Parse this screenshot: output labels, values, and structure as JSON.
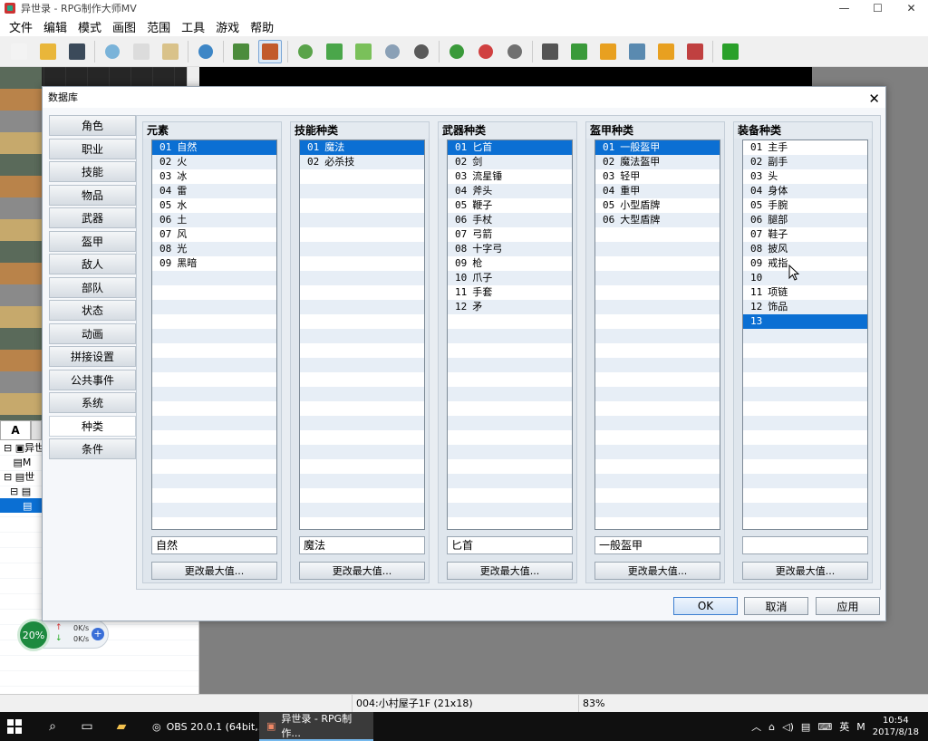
{
  "window": {
    "title": "异世录 - RPG制作大师MV",
    "minimize": "—",
    "maximize": "☐",
    "close": "✕"
  },
  "menu": [
    "文件",
    "编辑",
    "模式",
    "画图",
    "范围",
    "工具",
    "游戏",
    "帮助"
  ],
  "toolbar": {
    "icons": [
      "new-project-icon",
      "open-project-icon",
      "save-icon",
      "cut-icon",
      "copy-icon",
      "paste-icon",
      "undo-icon",
      "map-mode-icon",
      "event-mode-icon",
      "pencil-icon",
      "rectangle-icon",
      "ellipse-icon",
      "fill-icon",
      "shadow-pen-icon",
      "zoom-in-icon",
      "zoom-out-icon",
      "zoom-actual-icon",
      "database-icon",
      "plugin-icon",
      "sound-test-icon",
      "event-search-icon",
      "resource-manager-icon",
      "character-generator-icon",
      "playtest-icon"
    ],
    "colors": [
      "#f3f3f3",
      "#e9b63a",
      "#3b4a5a",
      "#7ab3d9",
      "#dcdcdc",
      "#d9c28a",
      "#3d86c6",
      "#4c8c3c",
      "#c25a2b",
      "#5aa34a",
      "#4aa64a",
      "#7ac05a",
      "#8aa0b6",
      "#5a5a5a",
      "#3a9a3a",
      "#d04040",
      "#707070",
      "#555555",
      "#3a9a3a",
      "#e8a020",
      "#5a8ab0",
      "#e8a020",
      "#c04040",
      "#2aa02a"
    ]
  },
  "left_panel": {
    "tab_a": "A",
    "tree": [
      "异世",
      "M",
      "世",
      "",
      ""
    ]
  },
  "network": {
    "percent": "20%",
    "up": "0K/s",
    "down": "0K/s",
    "up_arrow": "↑",
    "down_arrow": "↓",
    "plus": "+"
  },
  "status": {
    "map": "004:小村屋子1F (21x18)",
    "zoom": "83%"
  },
  "taskbar": {
    "apps": [
      {
        "label": "OBS 20.0.1 (64bit,..."
      },
      {
        "label": "异世录 - RPG制作..."
      }
    ],
    "tray_ime": "英",
    "tray_m": "M",
    "time": "10:54",
    "date": "2017/8/18"
  },
  "dialog": {
    "title": "数据库",
    "close": "✕",
    "nav": [
      "角色",
      "职业",
      "技能",
      "物品",
      "武器",
      "盔甲",
      "敌人",
      "部队",
      "状态",
      "动画",
      "拼接设置",
      "公共事件",
      "系统",
      "种类",
      "条件"
    ],
    "selected_nav": 13,
    "columns": [
      {
        "title": "元素",
        "items": [
          {
            "num": "01",
            "name": "自然"
          },
          {
            "num": "02",
            "name": "火"
          },
          {
            "num": "03",
            "name": "冰"
          },
          {
            "num": "04",
            "name": "雷"
          },
          {
            "num": "05",
            "name": "水"
          },
          {
            "num": "06",
            "name": "土"
          },
          {
            "num": "07",
            "name": "风"
          },
          {
            "num": "08",
            "name": "光"
          },
          {
            "num": "09",
            "name": "黑暗"
          }
        ],
        "selected": 0,
        "field": "自然",
        "button": "更改最大值..."
      },
      {
        "title": "技能种类",
        "items": [
          {
            "num": "01",
            "name": "魔法"
          },
          {
            "num": "02",
            "name": "必杀技"
          }
        ],
        "selected": 0,
        "field": "魔法",
        "button": "更改最大值..."
      },
      {
        "title": "武器种类",
        "items": [
          {
            "num": "01",
            "name": "匕首"
          },
          {
            "num": "02",
            "name": "剑"
          },
          {
            "num": "03",
            "name": "流星锤"
          },
          {
            "num": "04",
            "name": "斧头"
          },
          {
            "num": "05",
            "name": "鞭子"
          },
          {
            "num": "06",
            "name": "手杖"
          },
          {
            "num": "07",
            "name": "弓箭"
          },
          {
            "num": "08",
            "name": "十字弓"
          },
          {
            "num": "09",
            "name": "枪"
          },
          {
            "num": "10",
            "name": "爪子"
          },
          {
            "num": "11",
            "name": "手套"
          },
          {
            "num": "12",
            "name": "矛"
          }
        ],
        "selected": 0,
        "field": "匕首",
        "button": "更改最大值..."
      },
      {
        "title": "盔甲种类",
        "items": [
          {
            "num": "01",
            "name": "一般盔甲"
          },
          {
            "num": "02",
            "name": "魔法盔甲"
          },
          {
            "num": "03",
            "name": "轻甲"
          },
          {
            "num": "04",
            "name": "重甲"
          },
          {
            "num": "05",
            "name": "小型盾牌"
          },
          {
            "num": "06",
            "name": "大型盾牌"
          }
        ],
        "selected": 0,
        "field": "一般盔甲",
        "button": "更改最大值..."
      },
      {
        "title": "装备种类",
        "items": [
          {
            "num": "01",
            "name": "主手"
          },
          {
            "num": "02",
            "name": "副手"
          },
          {
            "num": "03",
            "name": "头"
          },
          {
            "num": "04",
            "name": "身体"
          },
          {
            "num": "05",
            "name": "手腕"
          },
          {
            "num": "06",
            "name": "腿部"
          },
          {
            "num": "07",
            "name": "鞋子"
          },
          {
            "num": "08",
            "name": "披风"
          },
          {
            "num": "09",
            "name": "戒指"
          },
          {
            "num": "10",
            "name": ""
          },
          {
            "num": "11",
            "name": "项链"
          },
          {
            "num": "12",
            "name": "饰品"
          },
          {
            "num": "13",
            "name": ""
          }
        ],
        "selected": 12,
        "field": "",
        "button": "更改最大值..."
      }
    ],
    "buttons": {
      "ok": "OK",
      "cancel": "取消",
      "apply": "应用"
    }
  }
}
